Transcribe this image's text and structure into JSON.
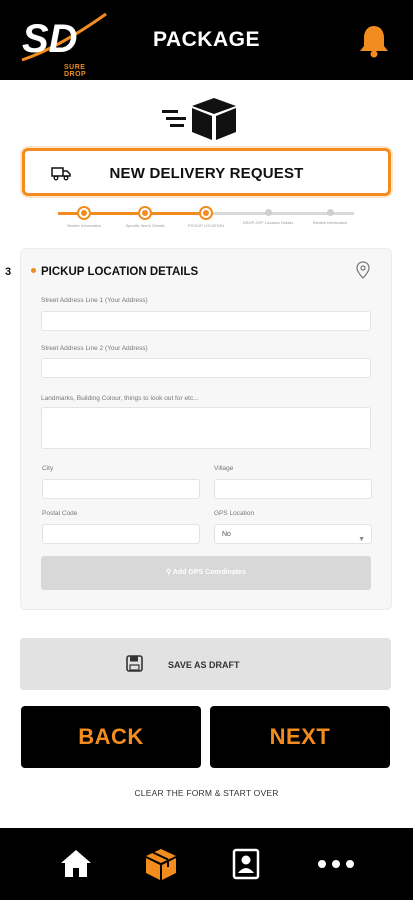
{
  "header": {
    "logo_text": "SD",
    "logo_sub": "SURE DROP",
    "title": "PACKAGE",
    "bell_icon": "bell-icon"
  },
  "request": {
    "title": "NEW DELIVERY REQUEST",
    "icon": "truck-icon"
  },
  "stepper": {
    "steps": [
      {
        "label": "Sender Information",
        "state": "done"
      },
      {
        "label": "Specific Item's Details",
        "state": "done"
      },
      {
        "label": "PICKUP LOCATION",
        "state": "current"
      },
      {
        "label": "DROP-OFF Location Details",
        "state": "todo"
      },
      {
        "label": "Review Information",
        "state": "todo"
      }
    ]
  },
  "side_number": "3",
  "form": {
    "title": "PICKUP LOCATION DETAILS",
    "street1_label": "Street Address Line 1 (Your Address)",
    "street1_value": "",
    "street2_label": "Street Address Line 2 (Your Address)",
    "street2_value": "",
    "landmarks_label": "Landmarks, Building Colour, things to look out for etc...",
    "landmarks_value": "",
    "city_label": "City",
    "city_value": "",
    "village_label": "Village",
    "village_value": "",
    "postal_label": "Postal Code",
    "postal_value": "",
    "gps_label": "GPS Location",
    "gps_value": "No",
    "gps_button": "Add GPS Coordinates"
  },
  "actions": {
    "save_draft": "SAVE AS DRAFT",
    "back": "BACK",
    "next": "NEXT",
    "clear": "CLEAR THE FORM & START OVER"
  },
  "nav": {
    "items": [
      "home-icon",
      "package-icon",
      "profile-icon",
      "more-icon"
    ]
  },
  "colors": {
    "accent": "#f28c1f",
    "dark": "#000000",
    "card": "#f7f7f7"
  }
}
